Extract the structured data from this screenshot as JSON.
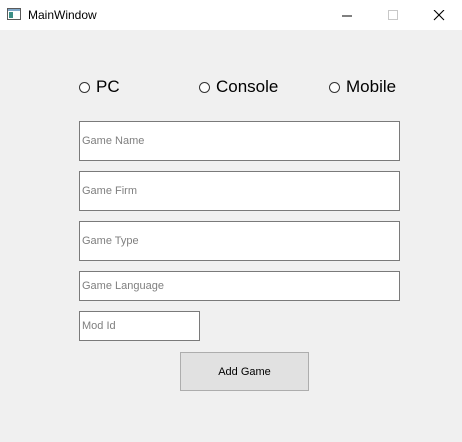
{
  "window": {
    "title": "MainWindow",
    "icon": "app-window-icon",
    "controls": [
      "minimize-icon",
      "maximize-icon",
      "close-icon"
    ]
  },
  "platform_options": [
    {
      "label": "PC",
      "selected": false
    },
    {
      "label": "Console",
      "selected": false
    },
    {
      "label": "Mobile",
      "selected": false
    }
  ],
  "form": {
    "game_name": {
      "value": "",
      "placeholder": "Game Name"
    },
    "game_firm": {
      "value": "",
      "placeholder": "Game Firm"
    },
    "game_type": {
      "value": "",
      "placeholder": "Game Type"
    },
    "game_language": {
      "value": "",
      "placeholder": "Game Language"
    },
    "mod_id": {
      "value": "",
      "placeholder": "Mod Id"
    }
  },
  "add_button_label": "Add Game"
}
